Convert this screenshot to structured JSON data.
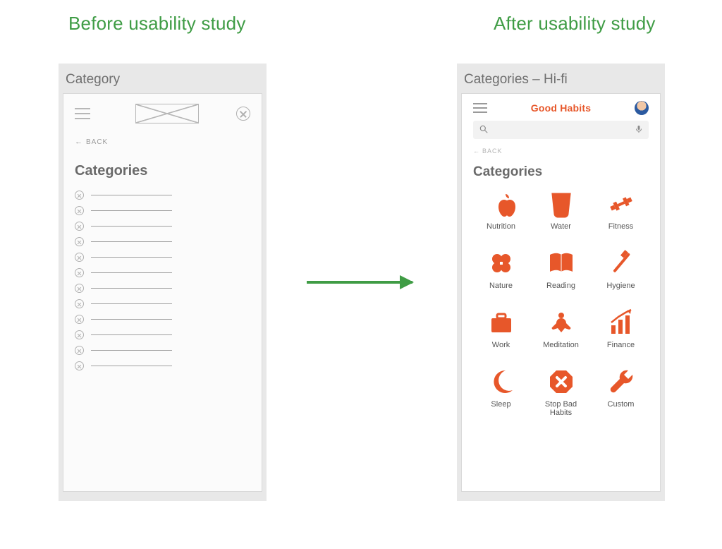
{
  "headings": {
    "before": "Before usability study",
    "after": "After usability study"
  },
  "colors": {
    "accent_green": "#3f9c45",
    "brand_orange": "#e7572a",
    "frame_gray": "#e8e8e8"
  },
  "left_mock": {
    "frame_title": "Category",
    "back_label": "BACK",
    "section_title": "Categories",
    "placeholder_row_count": 12
  },
  "right_mock": {
    "frame_title": "Categories – Hi-fi",
    "brand": "Good Habits",
    "search_placeholder": "",
    "back_label": "BACK",
    "section_title": "Categories",
    "categories": [
      {
        "id": "nutrition",
        "label": "Nutrition",
        "icon": "apple-icon"
      },
      {
        "id": "water",
        "label": "Water",
        "icon": "cup-icon"
      },
      {
        "id": "fitness",
        "label": "Fitness",
        "icon": "dumbbell-icon"
      },
      {
        "id": "nature",
        "label": "Nature",
        "icon": "clover-icon"
      },
      {
        "id": "reading",
        "label": "Reading",
        "icon": "book-icon"
      },
      {
        "id": "hygiene",
        "label": "Hygiene",
        "icon": "toothbrush-icon"
      },
      {
        "id": "work",
        "label": "Work",
        "icon": "briefcase-icon"
      },
      {
        "id": "meditation",
        "label": "Meditation",
        "icon": "meditation-icon"
      },
      {
        "id": "finance",
        "label": "Finance",
        "icon": "chart-icon"
      },
      {
        "id": "sleep",
        "label": "Sleep",
        "icon": "moon-icon"
      },
      {
        "id": "stopbad",
        "label": "Stop Bad Habits",
        "icon": "stop-icon"
      },
      {
        "id": "custom",
        "label": "Custom",
        "icon": "wrench-icon"
      }
    ]
  }
}
